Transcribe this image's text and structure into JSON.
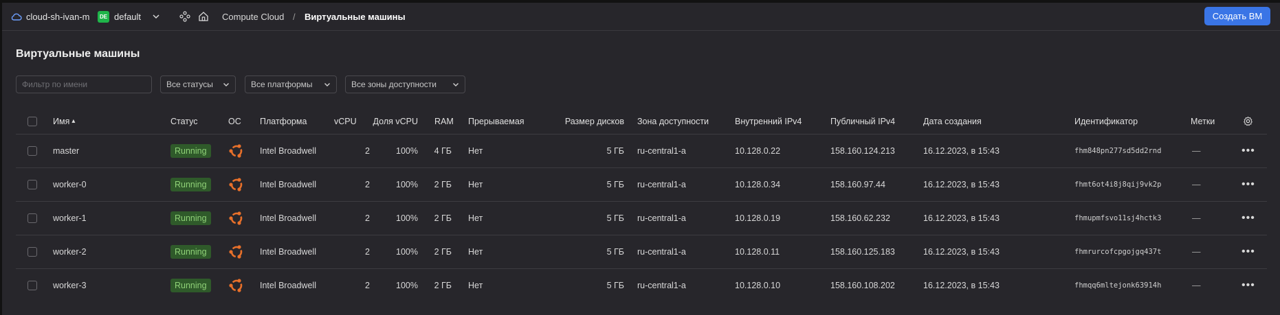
{
  "header": {
    "cloud_name": "cloud-sh-ivan-m",
    "folder_badge": "DE",
    "folder_name": "default",
    "breadcrumb_service": "Compute Cloud",
    "breadcrumb_separator": "/",
    "breadcrumb_current": "Виртуальные машины",
    "create_button": "Создать ВМ"
  },
  "page_title": "Виртуальные машины",
  "filters": {
    "name_placeholder": "Фильтр по имени",
    "status": "Все статусы",
    "platform": "Все платформы",
    "zone": "Все зоны доступности"
  },
  "columns": {
    "name": "Имя",
    "sort_indicator": "▴",
    "status": "Статус",
    "os": "ОС",
    "platform": "Платформа",
    "vcpu": "vCPU",
    "vcpu_share": "Доля vCPU",
    "ram": "RAM",
    "preemptible": "Прерываемая",
    "disk_size": "Размер дисков",
    "zone": "Зона доступности",
    "internal_ip": "Внутренний IPv4",
    "public_ip": "Публичный IPv4",
    "created": "Дата создания",
    "id": "Идентификатор",
    "labels": "Метки"
  },
  "rows": [
    {
      "name": "master",
      "status": "Running",
      "platform": "Intel Broadwell",
      "vcpu": "2",
      "vcpu_share": "100%",
      "ram": "4 ГБ",
      "preemptible": "Нет",
      "disk": "5 ГБ",
      "zone": "ru-central1-a",
      "internal_ip": "10.128.0.22",
      "public_ip": "158.160.124.213",
      "created": "16.12.2023, в 15:43",
      "id": "fhm848pn277sd5dd2rnd",
      "labels": "—"
    },
    {
      "name": "worker-0",
      "status": "Running",
      "platform": "Intel Broadwell",
      "vcpu": "2",
      "vcpu_share": "100%",
      "ram": "2 ГБ",
      "preemptible": "Нет",
      "disk": "5 ГБ",
      "zone": "ru-central1-a",
      "internal_ip": "10.128.0.34",
      "public_ip": "158.160.97.44",
      "created": "16.12.2023, в 15:43",
      "id": "fhmt6ot4i8j8qij9vk2p",
      "labels": "—"
    },
    {
      "name": "worker-1",
      "status": "Running",
      "platform": "Intel Broadwell",
      "vcpu": "2",
      "vcpu_share": "100%",
      "ram": "2 ГБ",
      "preemptible": "Нет",
      "disk": "5 ГБ",
      "zone": "ru-central1-a",
      "internal_ip": "10.128.0.19",
      "public_ip": "158.160.62.232",
      "created": "16.12.2023, в 15:43",
      "id": "fhmupmfsvo11sj4hctk3",
      "labels": "—"
    },
    {
      "name": "worker-2",
      "status": "Running",
      "platform": "Intel Broadwell",
      "vcpu": "2",
      "vcpu_share": "100%",
      "ram": "2 ГБ",
      "preemptible": "Нет",
      "disk": "5 ГБ",
      "zone": "ru-central1-a",
      "internal_ip": "10.128.0.11",
      "public_ip": "158.160.125.183",
      "created": "16.12.2023, в 15:43",
      "id": "fhmrurcofcpgojgq437t",
      "labels": "—"
    },
    {
      "name": "worker-3",
      "status": "Running",
      "platform": "Intel Broadwell",
      "vcpu": "2",
      "vcpu_share": "100%",
      "ram": "2 ГБ",
      "preemptible": "Нет",
      "disk": "5 ГБ",
      "zone": "ru-central1-a",
      "internal_ip": "10.128.0.10",
      "public_ip": "158.160.108.202",
      "created": "16.12.2023, в 15:43",
      "id": "fhmqq6mltejonk63914h",
      "labels": "—"
    }
  ],
  "colors": {
    "accent": "#3a75e6",
    "running_bg": "#2f5a2a",
    "running_text": "#8fd177",
    "os_icon": "#e8702a"
  },
  "icons": {
    "cloud": "cloud-icon",
    "os": "ubuntu-icon",
    "settings": "gear-icon",
    "row_menu": "more-dots-icon"
  }
}
